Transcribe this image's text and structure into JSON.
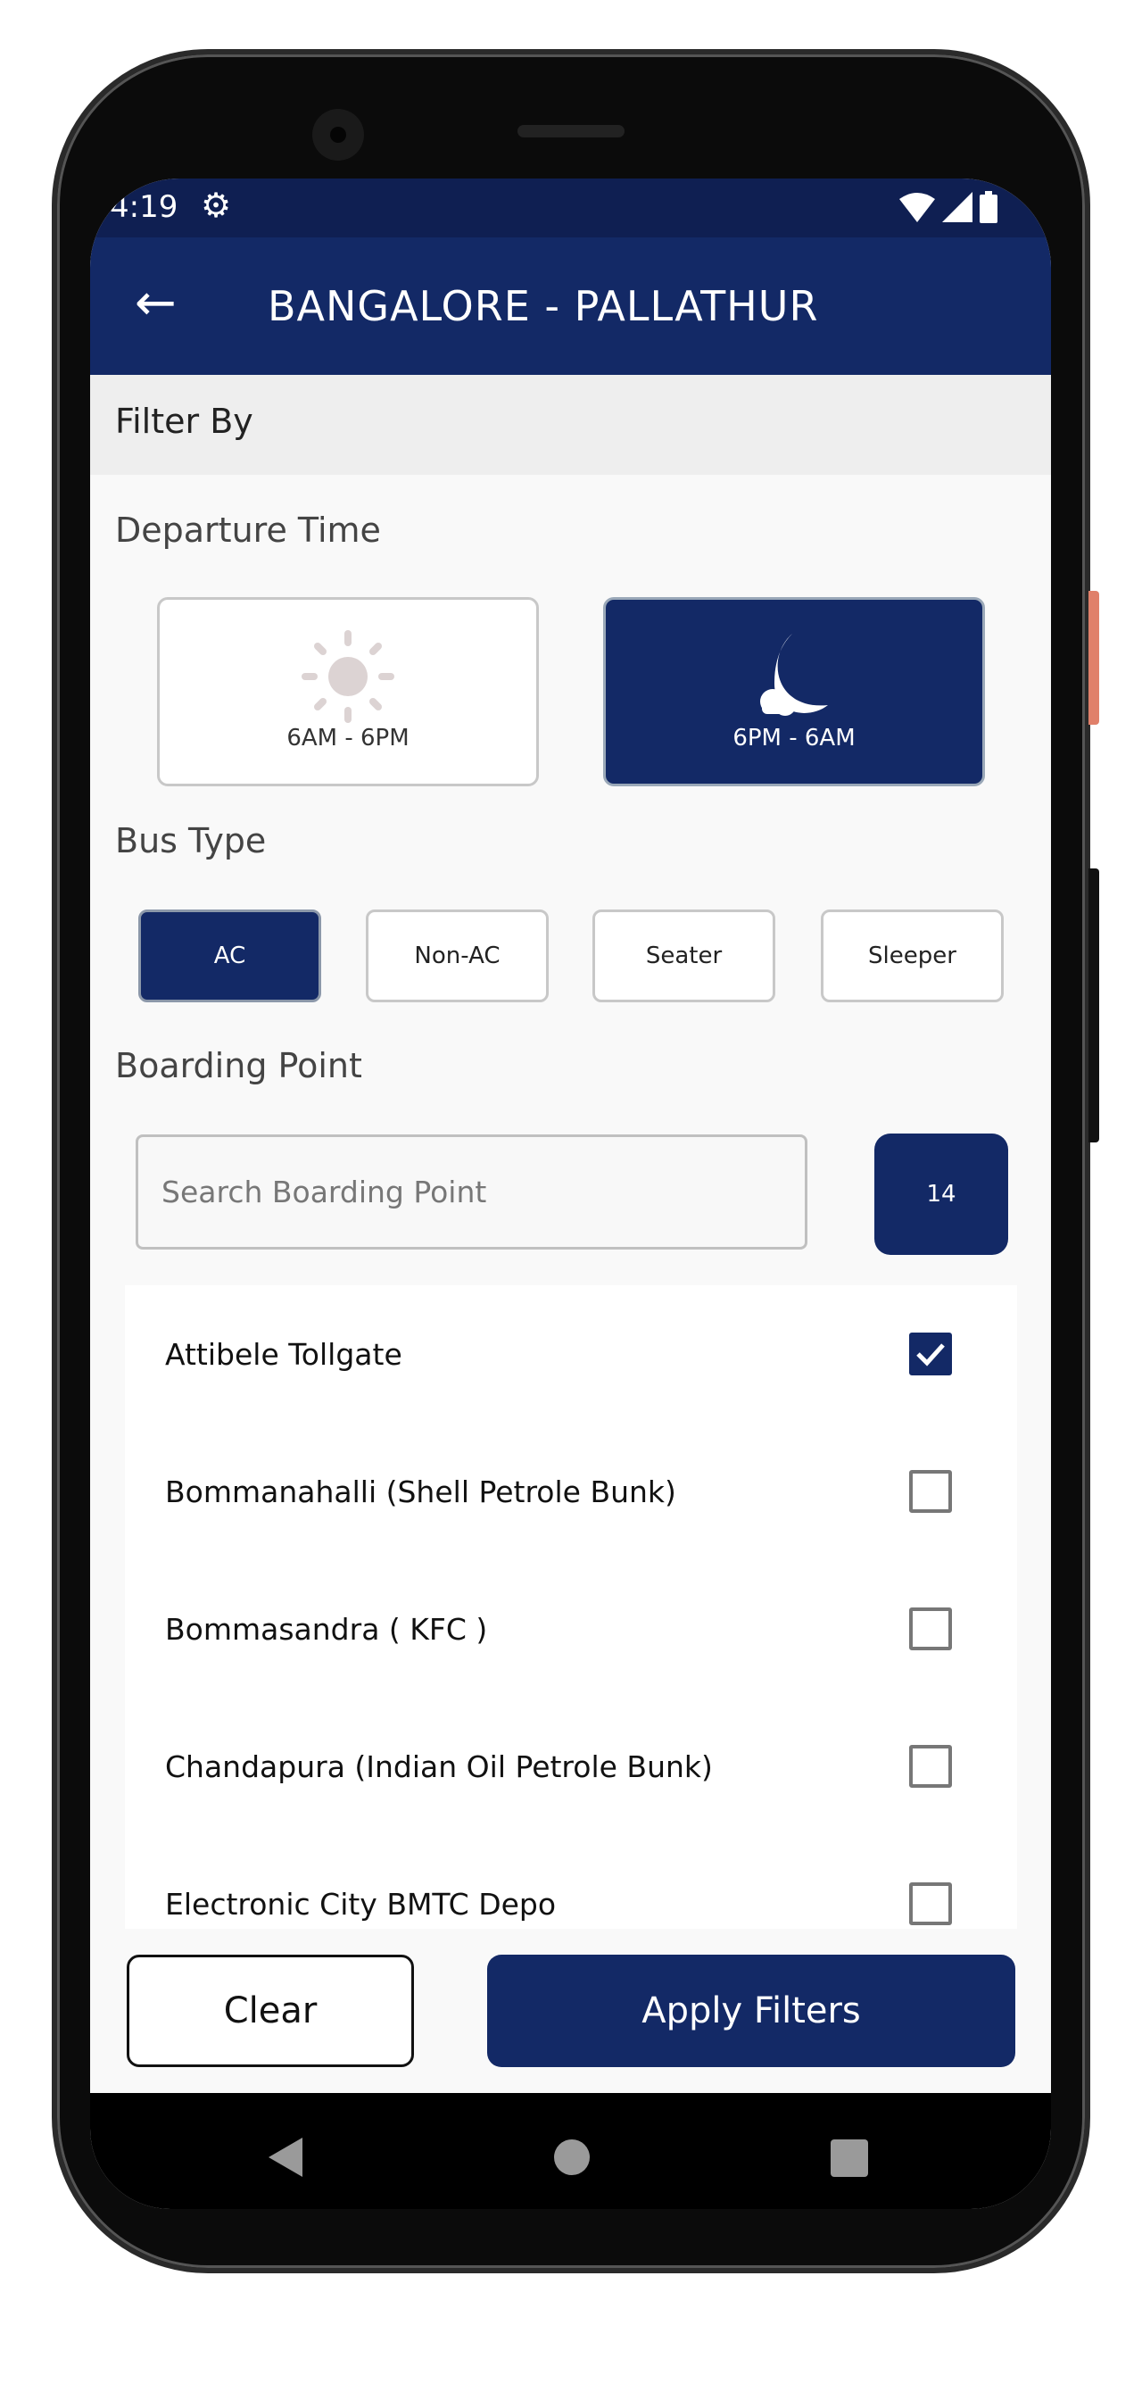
{
  "status_bar": {
    "time": "4:19",
    "icons": [
      "gear-icon",
      "wifi-icon",
      "signal-icon",
      "battery-icon"
    ]
  },
  "app_bar": {
    "title": "BANGALORE - PALLATHUR",
    "back_icon": "arrow-left-icon"
  },
  "filter_header": "Filter By",
  "departure_time": {
    "label": "Departure Time",
    "options": [
      {
        "label": "6AM - 6PM",
        "icon": "sun-icon",
        "selected": false
      },
      {
        "label": "6PM - 6AM",
        "icon": "moon-cloud-icon",
        "selected": true
      }
    ]
  },
  "bus_type": {
    "label": "Bus Type",
    "options": [
      {
        "label": "AC",
        "selected": true
      },
      {
        "label": "Non-AC",
        "selected": false
      },
      {
        "label": "Seater",
        "selected": false
      },
      {
        "label": "Sleeper",
        "selected": false
      }
    ]
  },
  "boarding_point": {
    "label": "Boarding Point",
    "search_placeholder": "Search Boarding Point",
    "search_value": "",
    "count": "14",
    "items": [
      {
        "label": "Attibele Tollgate",
        "checked": true
      },
      {
        "label": "Bommanahalli (Shell Petrole Bunk)",
        "checked": false
      },
      {
        "label": "Bommasandra ( KFC )",
        "checked": false
      },
      {
        "label": "Chandapura (Indian Oil Petrole Bunk)",
        "checked": false
      },
      {
        "label": "Electronic City  BMTC Depo",
        "checked": false
      }
    ]
  },
  "actions": {
    "clear": "Clear",
    "apply": "Apply Filters"
  },
  "colors": {
    "primary": "#132966",
    "status_bar": "#0f1f52",
    "filter_header_bg": "#eeeeee",
    "background": "#f9f9f9"
  }
}
